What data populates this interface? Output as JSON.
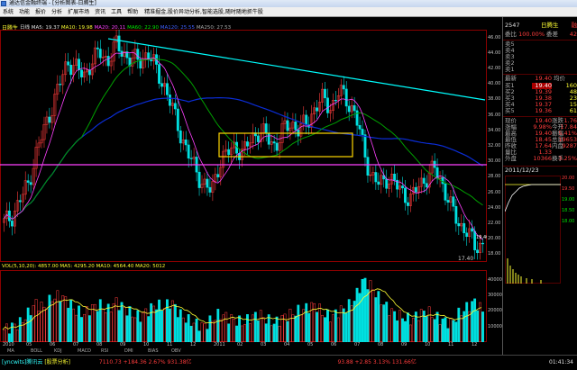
{
  "window": {
    "title": "通达信金融终端 - [分析图表-日腾生]"
  },
  "menu": {
    "items": [
      "系统",
      "功能",
      "报价",
      "分析",
      "扩展市场",
      "资讯",
      "工具",
      "帮助"
    ],
    "note": "精准掘金,股价异动分析,智能选股,随时随地抓牛股"
  },
  "stock": {
    "name": "日腾生",
    "code": "2547",
    "period": "日线"
  },
  "ma_legend": {
    "period": "日线",
    "ma1": "MA5: 19.37",
    "ma2": "MA10: 19.98",
    "ma3": "MA20: 20.11",
    "ma4": "MA60: 22.90",
    "ma5": "MA120: 25.55",
    "ma6": "MA250: 27.53"
  },
  "volume_legend": "VOL(5,10,20): 4857.00  MA5: 4295.20  MA10: 4564.40  MA20: 5012",
  "price_axis": [
    "46.00",
    "44.00",
    "42.00",
    "40.00",
    "38.00",
    "36.00",
    "34.00",
    "32.00",
    "30.00",
    "28.00",
    "26.00",
    "24.00",
    "22.00",
    "20.00",
    "18.00"
  ],
  "volume_axis": [
    "40000",
    "30000",
    "20000",
    "10000"
  ],
  "time_axis": [
    "2010",
    "05",
    "06",
    "07",
    "08",
    "09",
    "10",
    "11",
    "12",
    "2011",
    "02",
    "03",
    "04",
    "05",
    "06",
    "07",
    "08",
    "09",
    "10",
    "11",
    "12"
  ],
  "bottom_tabs": [
    "MA",
    "BOLL",
    "KDJ",
    "MACD",
    "RSI",
    "DMI",
    "BIAS",
    "OBV"
  ],
  "chart_data": {
    "type": "candlestick",
    "title": "",
    "ylim": [
      17,
      47
    ],
    "annotations": {
      "low_label": "17.40",
      "current_price_tag": "19.40"
    },
    "close_points": [
      22,
      23,
      25,
      27,
      31,
      34,
      37,
      40,
      43,
      42,
      41,
      43,
      44,
      43,
      45,
      44,
      43,
      43,
      44,
      42,
      40,
      37,
      34,
      31,
      29,
      27,
      26,
      30,
      31,
      32,
      31,
      33,
      34,
      33,
      32,
      34,
      35,
      34,
      35,
      37,
      38,
      37,
      39,
      38,
      36,
      32,
      28,
      27,
      28,
      27,
      26,
      25,
      27,
      28,
      29,
      27,
      24,
      22,
      21,
      19,
      19.4
    ],
    "volume_points": [
      8,
      10,
      12,
      18,
      25,
      22,
      28,
      30,
      26,
      20,
      18,
      22,
      24,
      20,
      26,
      22,
      18,
      16,
      20,
      24,
      22,
      26,
      18,
      14,
      12,
      10,
      14,
      18,
      16,
      14,
      12,
      16,
      18,
      14,
      12,
      16,
      18,
      20,
      22,
      24,
      18,
      16,
      20,
      22,
      28,
      40,
      36,
      28,
      22,
      18,
      16,
      14,
      18,
      20,
      16,
      14,
      12,
      18,
      22,
      26,
      20
    ]
  },
  "quote": {
    "header_code": "2547",
    "header_name": "日腾生",
    "header_flag": "融",
    "ratio_label": "委比",
    "ratio_value": "100.00%",
    "diff_label": "委差",
    "diff_value": "42",
    "sell_rows": [
      {
        "label": "卖5",
        "price": "",
        "vol": ""
      },
      {
        "label": "卖4",
        "price": "",
        "vol": ""
      },
      {
        "label": "卖3",
        "price": "",
        "vol": ""
      },
      {
        "label": "卖2",
        "price": "",
        "vol": ""
      },
      {
        "label": "卖1",
        "price": "",
        "vol": ""
      }
    ],
    "latest_label": "最新",
    "latest_value": "19.40",
    "latest2_label": "均价",
    "latest2_value": "19.39",
    "buy_rows": [
      {
        "label": "买1",
        "price": "19.40",
        "vol": "160"
      },
      {
        "label": "买2",
        "price": "19.39",
        "vol": "48"
      },
      {
        "label": "买3",
        "price": "19.38",
        "vol": "23"
      },
      {
        "label": "买4",
        "price": "19.37",
        "vol": "15"
      },
      {
        "label": "买5",
        "price": "19.36",
        "vol": "61"
      }
    ],
    "stats": [
      {
        "l": "现价",
        "v": "19.40",
        "l2": "涨跌",
        "v2": "1.76"
      },
      {
        "l": "涨幅",
        "v": "9.98%",
        "l2": "今开",
        "v2": "17.84"
      },
      {
        "l": "最高",
        "v": "19.40",
        "l2": "振幅",
        "v2": "5.41%"
      },
      {
        "l": "最低",
        "v": "18.45",
        "l2": "总量",
        "v2": "19653"
      },
      {
        "l": "昨收",
        "v": "17.64",
        "l2": "内盘",
        "v2": "9287"
      },
      {
        "l": "量比",
        "v": "1.33",
        "l2": "",
        "v2": ""
      },
      {
        "l": "外盘",
        "v": "10366",
        "l2": "换手",
        "v2": "3.25%"
      }
    ],
    "date_label": "2011/12/23",
    "mini_axis": [
      "20.00",
      "19.50",
      "19.00",
      "18.50",
      "18.00"
    ]
  },
  "status": {
    "tab1": "[yncwits]腾讯云",
    "tab2": "[股票分析]",
    "index1": "7110.73 +184.36 2.67% 931.38亿",
    "index2": "93.88 +2.85 3.13% 131.66亿",
    "clock": "01:41:34"
  }
}
